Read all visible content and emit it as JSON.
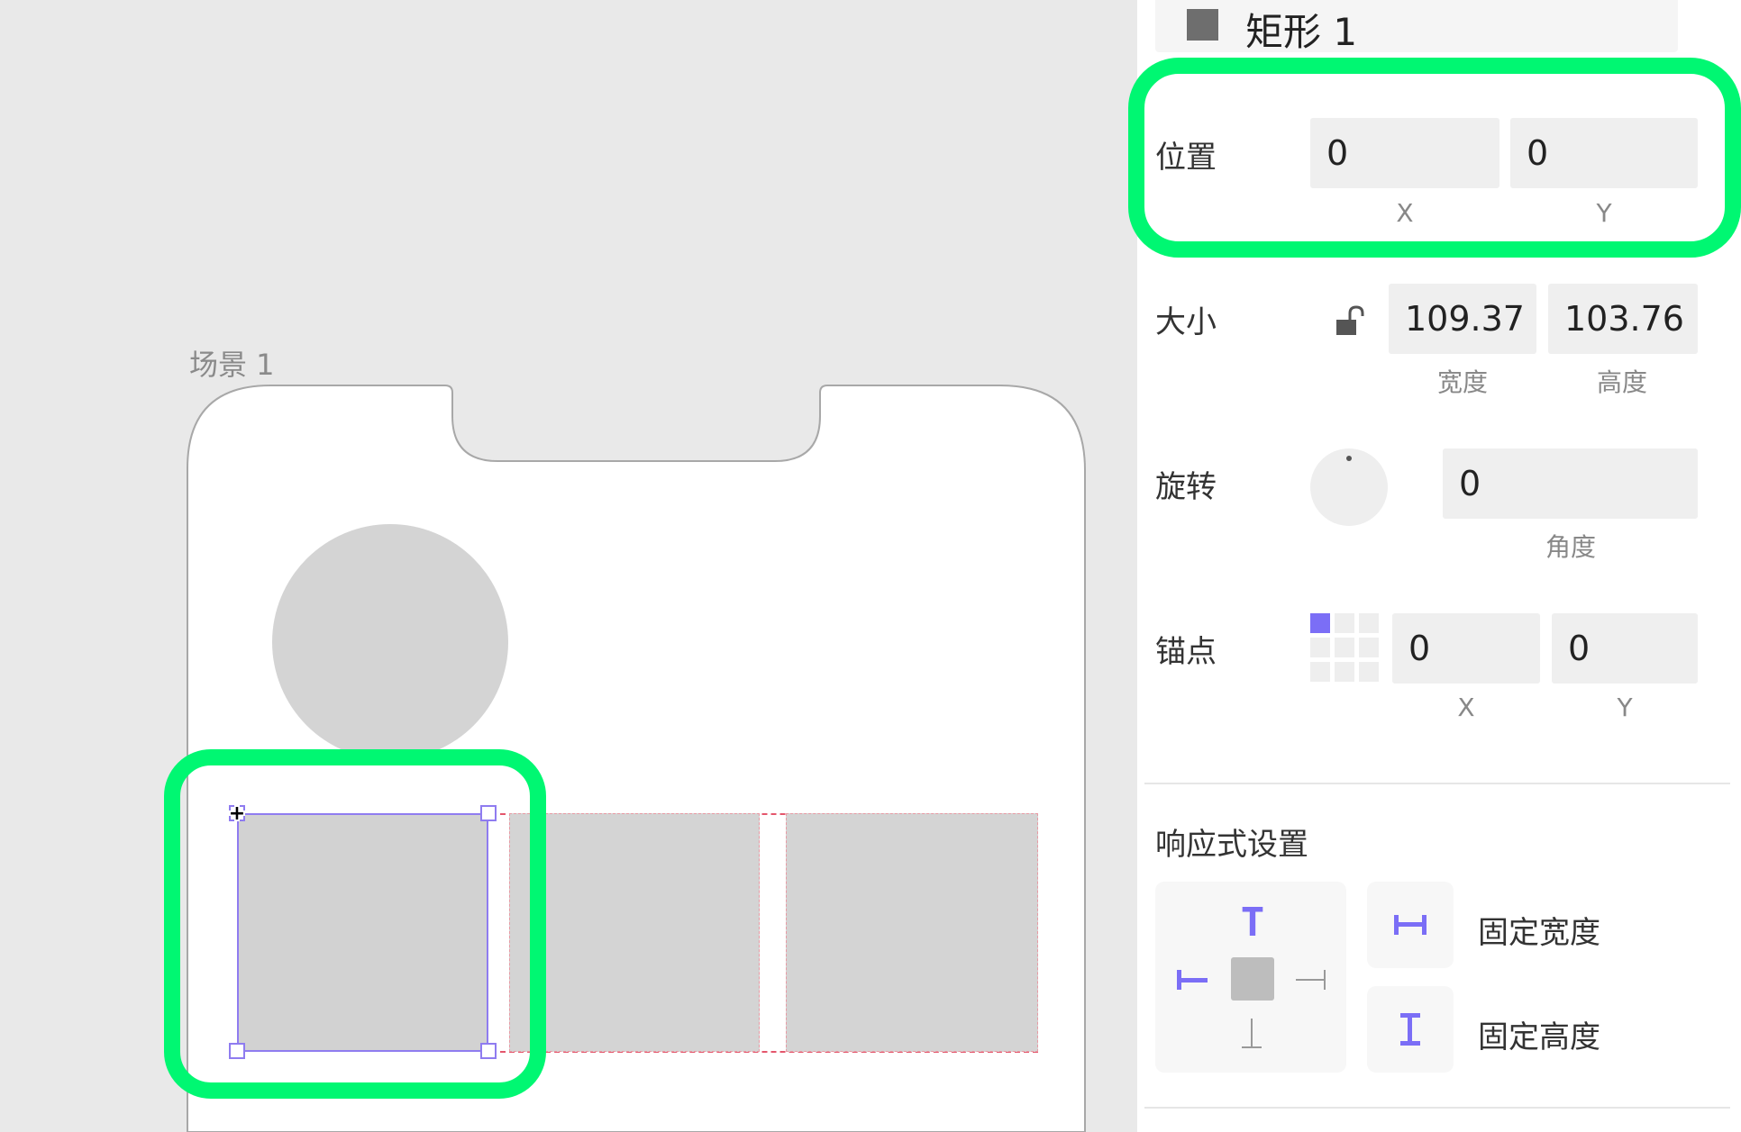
{
  "canvas": {
    "scene_label": "场景 1"
  },
  "inspector": {
    "layer_name": "矩形 1",
    "position": {
      "label": "位置",
      "x_value": "0",
      "y_value": "0",
      "x_caption": "X",
      "y_caption": "Y"
    },
    "size": {
      "label": "大小",
      "width_value": "109.37",
      "height_value": "103.76",
      "width_caption": "宽度",
      "height_caption": "高度",
      "lock_icon": "unlock-icon"
    },
    "rotation": {
      "label": "旋转",
      "value": "0",
      "caption": "角度",
      "knob_icon": "rotation-knob-icon"
    },
    "anchor": {
      "label": "锚点",
      "x_value": "0",
      "y_value": "0",
      "x_caption": "X",
      "y_caption": "Y",
      "selected_cell": "top-left"
    },
    "responsive": {
      "label": "响应式设置",
      "fixed_width_label": "固定宽度",
      "fixed_height_label": "固定高度"
    }
  },
  "colors": {
    "accent": "#7b6ef6",
    "highlight": "#00f772",
    "guide": "#e4566c",
    "placeholder": "#d4d4d4"
  }
}
